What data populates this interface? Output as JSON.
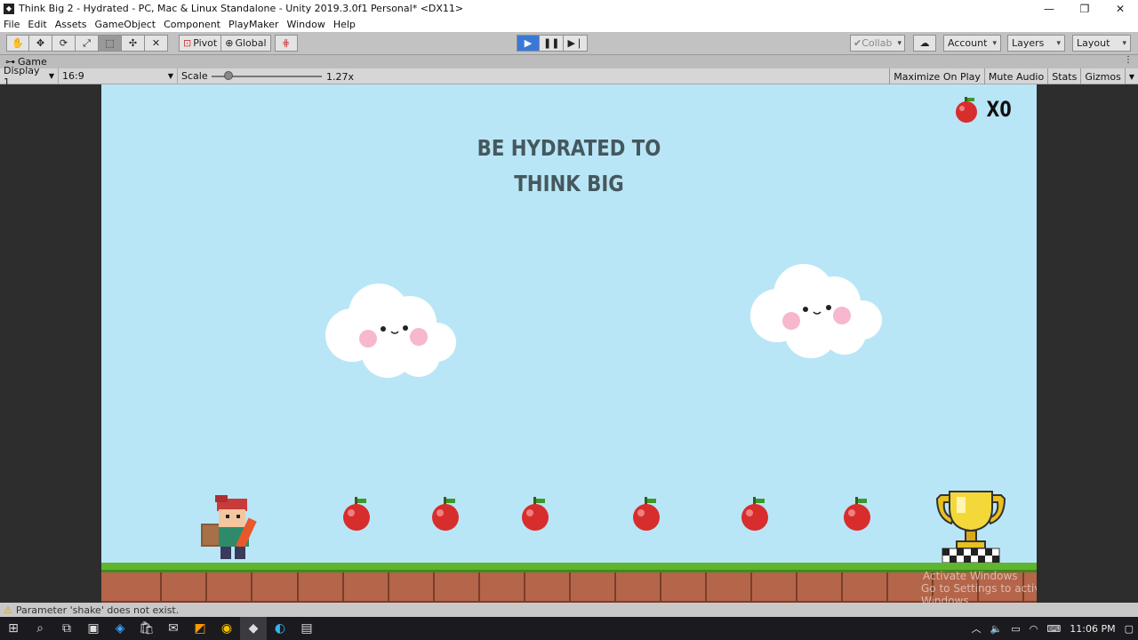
{
  "window": {
    "title": "Think Big 2 - Hydrated - PC, Mac & Linux Standalone - Unity 2019.3.0f1 Personal* <DX11>",
    "minimize": "—",
    "maximize": "❐",
    "close": "✕"
  },
  "menu": [
    "File",
    "Edit",
    "Assets",
    "GameObject",
    "Component",
    "PlayMaker",
    "Window",
    "Help"
  ],
  "toolbar": {
    "pivot_label": "Pivot",
    "global_label": "Global",
    "collab_label": "Collab",
    "account_label": "Account",
    "layers_label": "Layers",
    "layout_label": "Layout"
  },
  "tab": {
    "label": "Game"
  },
  "gamebar": {
    "display": "Display 1",
    "aspect": "16:9",
    "scale_label": "Scale",
    "scale_value": "1.27x",
    "maximize": "Maximize On Play",
    "mute": "Mute Audio",
    "stats": "Stats",
    "gizmos": "Gizmos"
  },
  "game": {
    "title_line1": "BE HYDRATED TO",
    "title_line2": "THINK BIG",
    "score": "X0",
    "apple_count": 6
  },
  "watermark": {
    "line1": "Activate Windows",
    "line2": "Go to Settings to activate Windows."
  },
  "status": {
    "message": "Parameter 'shake' does not exist."
  },
  "taskbar": {
    "time": "11:06 PM"
  },
  "colors": {
    "sky": "#b9e6f6",
    "title_text": "#44585e",
    "grass": "#5fb52e",
    "dirt": "#b5654a",
    "play_active": "#3a78d6"
  }
}
